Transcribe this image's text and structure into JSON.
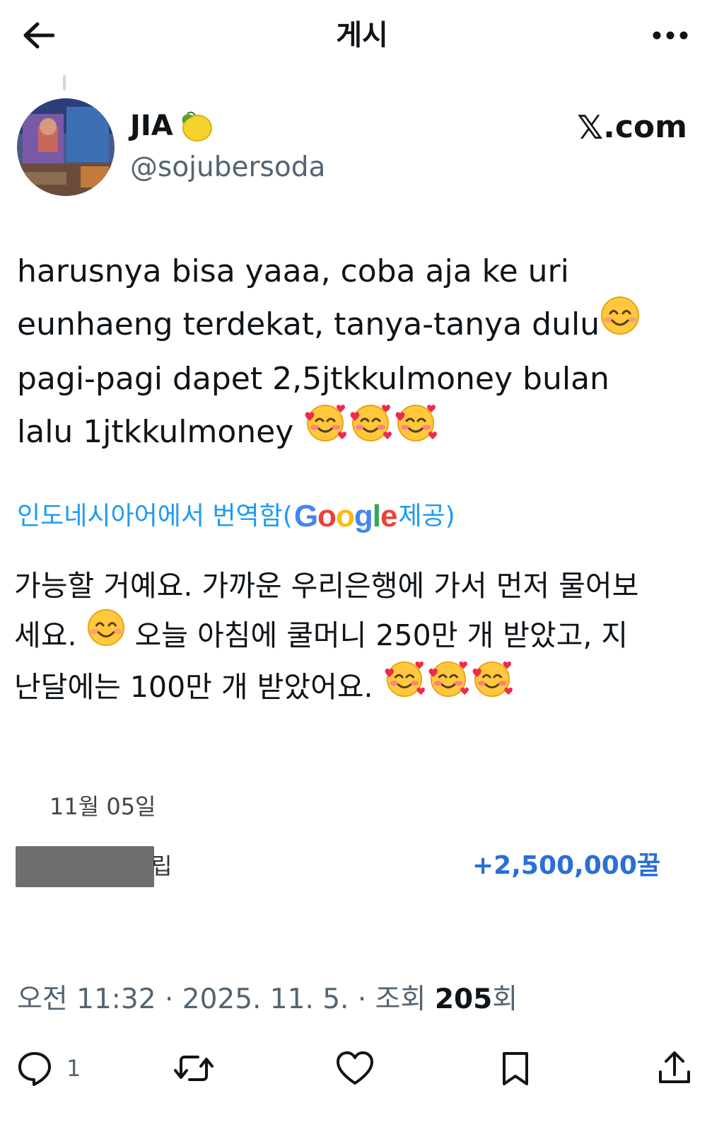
{
  "header": {
    "title": "게시"
  },
  "profile": {
    "display_name": "JIA",
    "handle": "@sojubersoda",
    "badge": "X.com",
    "badge_x": "𝕏",
    "badge_rest": ".com"
  },
  "tweet": {
    "lines": [
      "harusnya bisa yaaa, coba aja ke uri",
      "eunhaeng terdekat, tanya-tanya dulu",
      "pagi-pagi dapet 2,5jtkkulmoney bulan",
      "lalu 1jtkkulmoney"
    ]
  },
  "translation": {
    "link_prefix": "인도네시아어에서 번역함(",
    "google": "Google",
    "link_suffix": " 제공)",
    "lines": [
      "가능할 거예요. 가까운 우리은행에 가서 먼저 물어보",
      "세요.",
      "오늘 아침에 쿨머니 250만 개 받았고, 지",
      "난달에는 100만 개 받았어요."
    ]
  },
  "attachment": {
    "date": "11월 05일",
    "row_tail": "립",
    "amount": "+2,500,000꿀"
  },
  "meta": {
    "time": "오전 11:32",
    "sep": " · ",
    "date": "2025. 11. 5.",
    "views_label": "조회 ",
    "views": "205",
    "views_suffix": "회"
  },
  "actions": {
    "reply_count": "1"
  },
  "colors": {
    "link": "#1d9bf0",
    "secondary": "#536471",
    "amount": "#2a6fd6"
  }
}
